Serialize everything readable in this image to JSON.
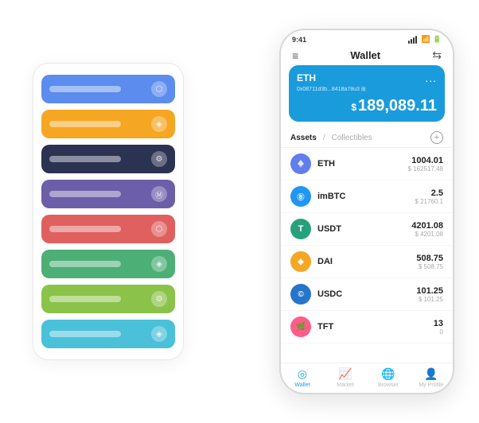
{
  "app": {
    "title": "Wallet"
  },
  "statusBar": {
    "time": "9:41",
    "signal": "signal",
    "wifi": "wifi",
    "battery": "battery"
  },
  "nav": {
    "menuIcon": "≡",
    "title": "Wallet",
    "scanIcon": "⇆"
  },
  "ethCard": {
    "name": "ETH",
    "dots": "...",
    "address": "0x08711d3b...8418a78u3  ⊞",
    "currencySymbol": "$",
    "balance": "189,089.11"
  },
  "assetsHeader": {
    "activeTab": "Assets",
    "separator": "/",
    "inactiveTab": "Collectibles",
    "addIcon": "+"
  },
  "assets": [
    {
      "id": "eth",
      "icon": "♦",
      "iconClass": "asset-icon-eth",
      "name": "ETH",
      "amount": "1004.01",
      "usdValue": "$ 162517.48"
    },
    {
      "id": "imbtc",
      "icon": "Ⓑ",
      "iconClass": "asset-icon-imbtc",
      "name": "imBTC",
      "amount": "2.5",
      "usdValue": "$ 21760.1"
    },
    {
      "id": "usdt",
      "icon": "T",
      "iconClass": "asset-icon-usdt",
      "name": "USDT",
      "amount": "4201.08",
      "usdValue": "$ 4201.08"
    },
    {
      "id": "dai",
      "icon": "◈",
      "iconClass": "asset-icon-dai",
      "name": "DAI",
      "amount": "508.75",
      "usdValue": "$ 508.75"
    },
    {
      "id": "usdc",
      "icon": "©",
      "iconClass": "asset-icon-usdc",
      "name": "USDC",
      "amount": "101.25",
      "usdValue": "$ 101.25"
    },
    {
      "id": "tft",
      "icon": "🌿",
      "iconClass": "asset-icon-tft",
      "name": "TFT",
      "amount": "13",
      "usdValue": "0"
    }
  ],
  "bottomNav": [
    {
      "id": "wallet",
      "icon": "◎",
      "label": "Wallet",
      "active": true
    },
    {
      "id": "market",
      "icon": "📊",
      "label": "Market",
      "active": false
    },
    {
      "id": "browser",
      "icon": "👤",
      "label": "Browser",
      "active": false
    },
    {
      "id": "profile",
      "icon": "⚙",
      "label": "My Profile",
      "active": false
    }
  ],
  "cardStack": [
    {
      "color": "card-blue",
      "text": "",
      "icon": "⬡"
    },
    {
      "color": "card-yellow",
      "text": "",
      "icon": "◈"
    },
    {
      "color": "card-dark",
      "text": "",
      "icon": "⚙"
    },
    {
      "color": "card-purple",
      "text": "",
      "icon": "Ⓜ"
    },
    {
      "color": "card-red",
      "text": "",
      "icon": "⬡"
    },
    {
      "color": "card-green",
      "text": "",
      "icon": "◈"
    },
    {
      "color": "card-lightgreen",
      "text": "",
      "icon": "⚙"
    },
    {
      "color": "card-skyblue",
      "text": "",
      "icon": "◈"
    }
  ]
}
